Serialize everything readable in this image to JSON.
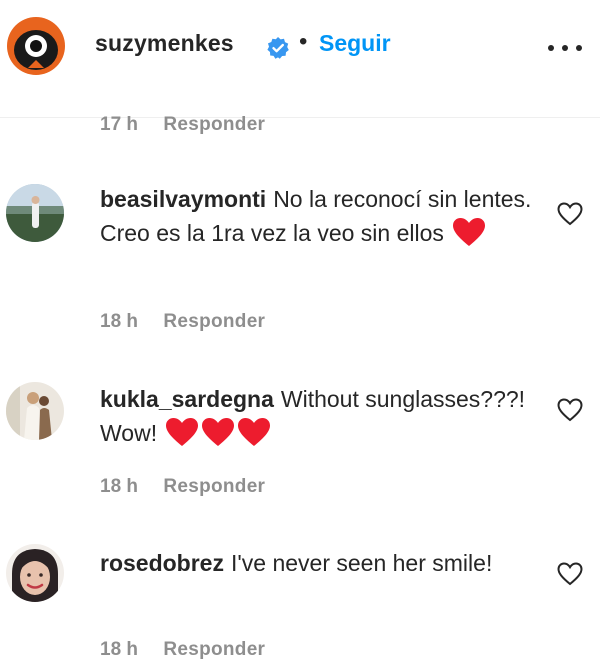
{
  "post": {
    "username": "suzymenkes",
    "separator": "•",
    "follow_label": "Seguir"
  },
  "top_meta": {
    "time": "17 h",
    "reply_label": "Responder"
  },
  "comments": [
    {
      "username": "beasilvaymonti",
      "text": "No la reconocí sin lentes. Creo es la 1ra vez la veo sin ellos",
      "emoji": "❤️",
      "time": "18 h",
      "reply_label": "Responder"
    },
    {
      "username": "kukla_sardegna",
      "text": "Without sunglasses???! Wow!",
      "emoji": "❤️❤️❤️",
      "time": "18 h",
      "reply_label": "Responder"
    },
    {
      "username": "rosedobrez",
      "text": "I've never seen her smile!",
      "emoji": "",
      "time": "18 h",
      "reply_label": "Responder"
    }
  ],
  "colors": {
    "accent": "#0095f6",
    "text": "#262626",
    "muted": "#8e8e8e",
    "heart": "#ed1c2e"
  },
  "icons": [
    "verified-badge-icon",
    "more-options-icon",
    "like-heart-icon",
    "red-heart-emoji"
  ]
}
